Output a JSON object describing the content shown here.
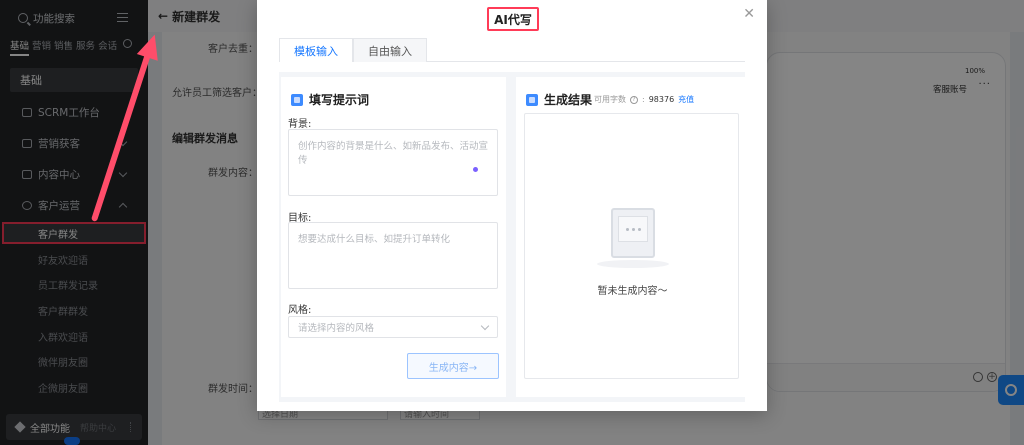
{
  "sidebar": {
    "search_label": "功能搜索",
    "tabs": [
      "基础",
      "营销",
      "销售",
      "服务",
      "会话"
    ],
    "section": "基础",
    "items": [
      {
        "label": "SCRM工作台"
      },
      {
        "label": "营销获客"
      },
      {
        "label": "内容中心"
      },
      {
        "label": "客户运营"
      }
    ],
    "subitems": [
      "客户群发",
      "好友欢迎语",
      "员工群发记录",
      "客户群群发",
      "入群欢迎语",
      "微伴朋友圈",
      "企微朋友圈"
    ],
    "bottom_label": "全部功能",
    "bottom_dim": "帮助中心"
  },
  "page": {
    "title": "新建群发",
    "labels": {
      "customer_dedup": "客户去重：",
      "allow_filter": "允许员工筛选客户：",
      "edit_section": "编辑群发消息",
      "content": "群发内容：",
      "time": "群发时间："
    },
    "date_placeholder": "选择日期",
    "time_placeholder": "请输入时间",
    "preview_title": "客服账号",
    "status": "100%"
  },
  "modal": {
    "title": "AI代写",
    "tabs": [
      "模板输入",
      "自由输入"
    ],
    "left": {
      "heading": "填写提示词",
      "background_label": "背景:",
      "background_placeholder": "创作内容的背景是什么、如新品发布、活动宣传",
      "goal_label": "目标:",
      "goal_placeholder": "想要达成什么目标、如提升订单转化",
      "style_label": "风格:",
      "style_placeholder": "请选择内容的风格",
      "generate_button": "生成内容→"
    },
    "right": {
      "heading": "生成结果",
      "count_label": "可用字数",
      "count_value": "98376",
      "recharge": "充值",
      "empty_text": "暂未生成内容～"
    }
  },
  "colors": {
    "accent": "#1677ff",
    "annotation": "#ff3b57",
    "sidebar_bg": "#242528"
  }
}
